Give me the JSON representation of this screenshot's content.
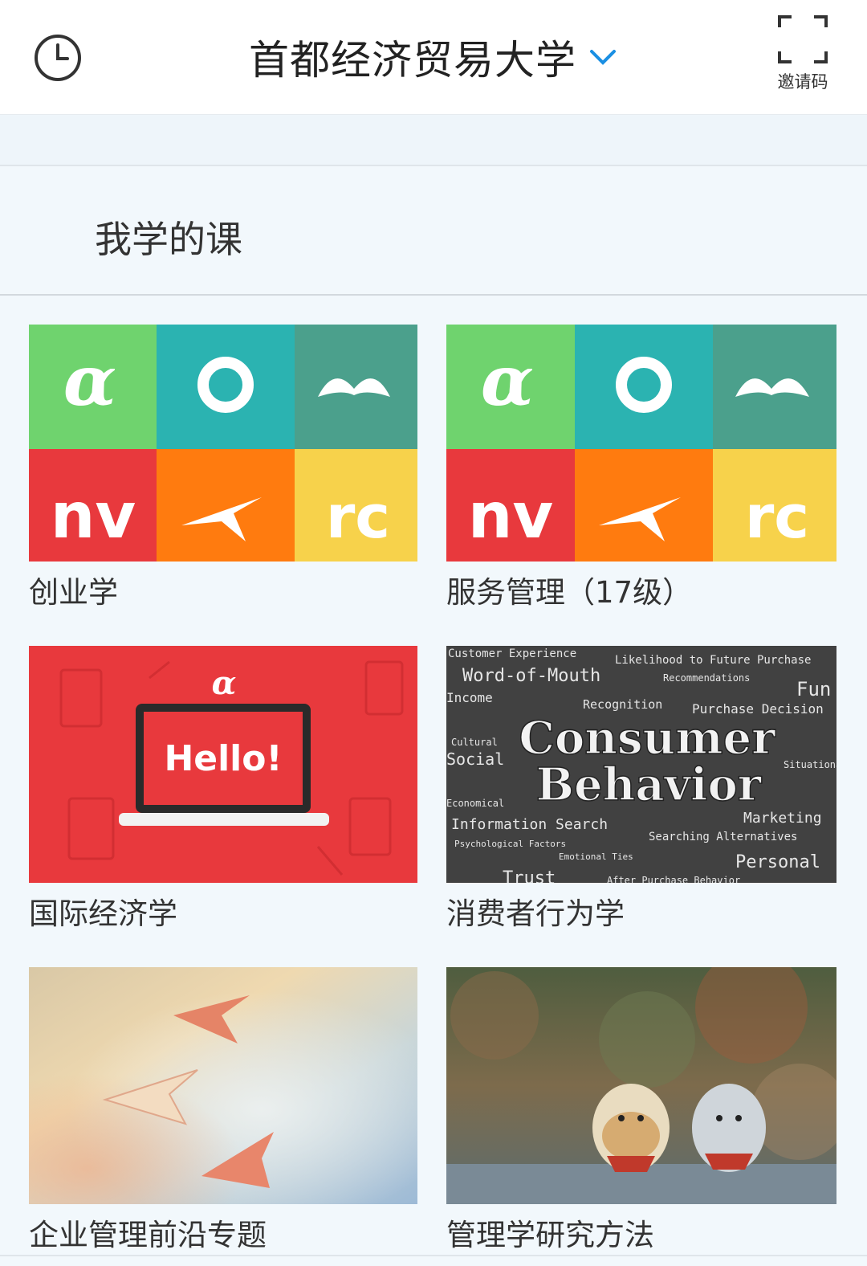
{
  "header": {
    "title": "首都经济贸易大学",
    "invite_label": "邀请码"
  },
  "section": {
    "title": "我学的课"
  },
  "courses": [
    {
      "name": "创业学",
      "cover": "colorful-app-icon-grid"
    },
    {
      "name": "服务管理（17级）",
      "cover": "colorful-app-icon-grid"
    },
    {
      "name": "国际经济学",
      "cover": "red-laptop-hello"
    },
    {
      "name": "消费者行为学",
      "cover": "chalkboard-words"
    },
    {
      "name": "企业管理前沿专题",
      "cover": "paper-planes-sky"
    },
    {
      "name": "管理学研究方法",
      "cover": "lucky-cat-figurines"
    }
  ],
  "covers": {
    "laptop_text": "Hello!",
    "chalk_title_1": "Consumer",
    "chalk_title_2": "Behavior",
    "chalk_words": [
      "Customer Experience",
      "Likelihood to Future Purchase",
      "Word-of-Mouth",
      "Recommendations",
      "Income",
      "Recognition",
      "Purchase Decision",
      "Cultural",
      "Social",
      "Situational",
      "Fun",
      "Economical",
      "Information Search",
      "Marketing",
      "Psychological Factors",
      "Searching Alternatives",
      "Emotional Ties",
      "Personal",
      "Trust",
      "After Purchase Behavior"
    ]
  },
  "colors": {
    "accent": "#1a8fe3",
    "tile_green": "#6fd36e",
    "tile_teal": "#2bb3b1",
    "tile_darkteal": "#4ba08c",
    "tile_red": "#e8393d",
    "tile_orange": "#ff7b0f",
    "tile_yellow": "#f7d24b"
  }
}
